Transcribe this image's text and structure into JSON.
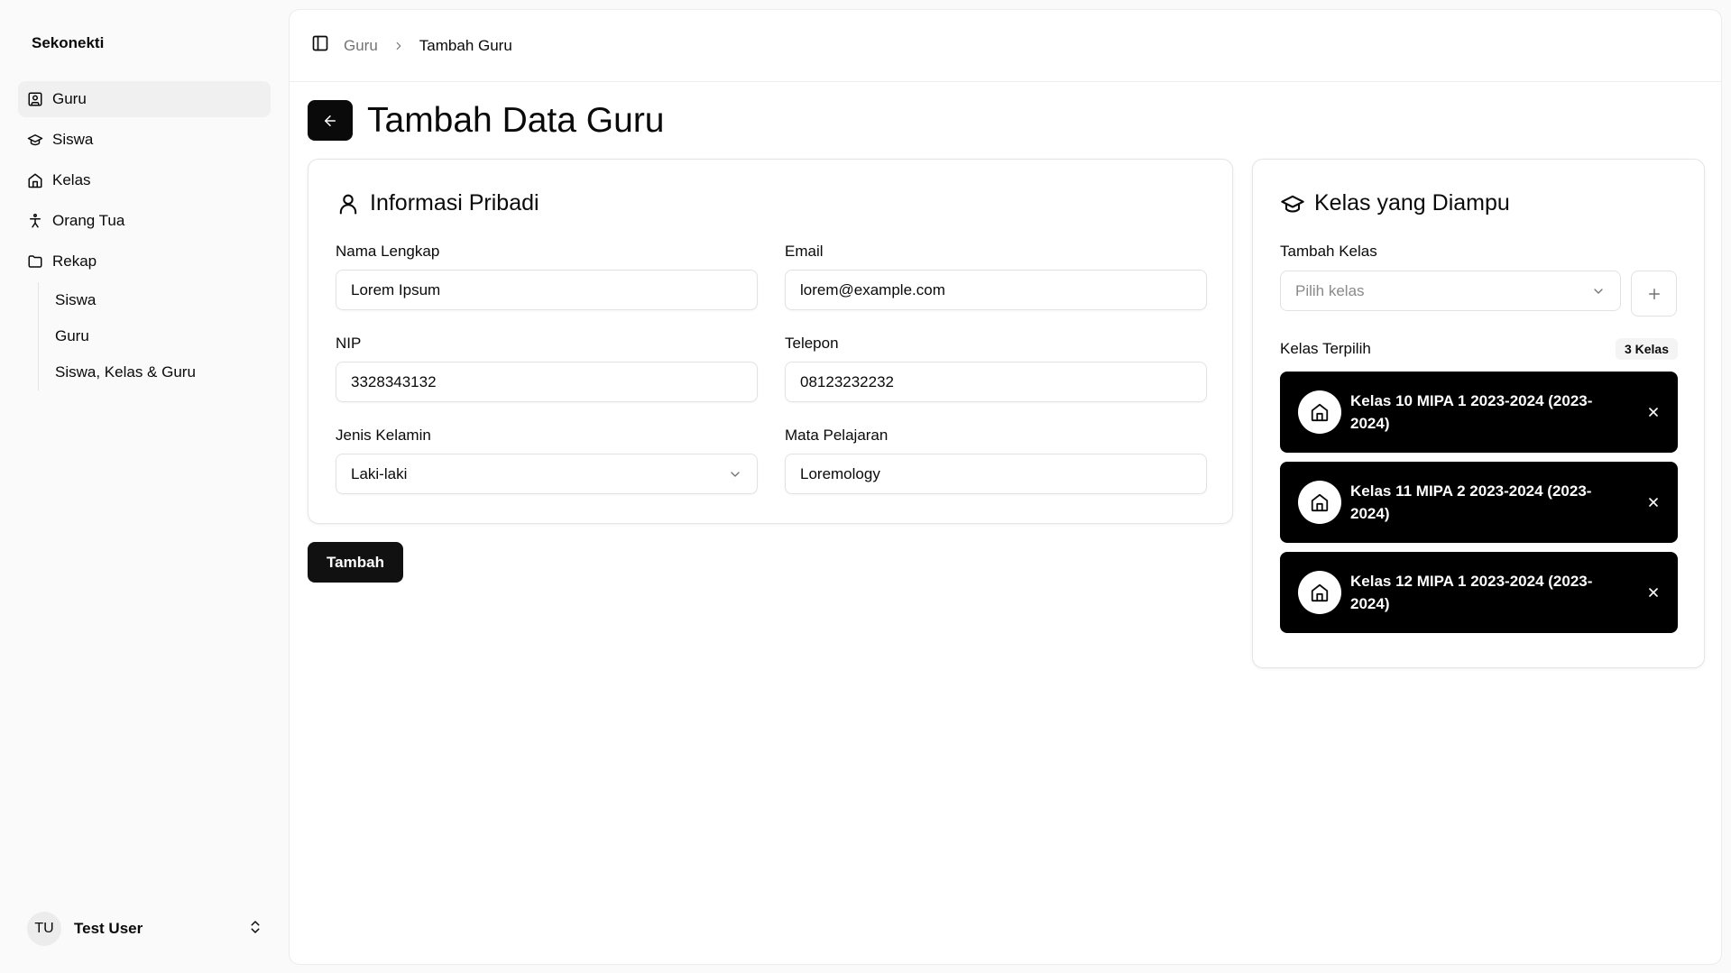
{
  "sidebar": {
    "brand": "Sekonekti",
    "items": [
      {
        "label": "Guru",
        "icon": "user-square-icon",
        "active": true
      },
      {
        "label": "Siswa",
        "icon": "graduation-cap-icon"
      },
      {
        "label": "Kelas",
        "icon": "home-icon"
      },
      {
        "label": "Orang Tua",
        "icon": "person-icon"
      },
      {
        "label": "Rekap",
        "icon": "folder-icon"
      }
    ],
    "rekap_sub": [
      "Siswa",
      "Guru",
      "Siswa, Kelas & Guru"
    ],
    "user": {
      "initials": "TU",
      "name": "Test User"
    }
  },
  "breadcrumb": {
    "parent": "Guru",
    "current": "Tambah Guru"
  },
  "page_title": "Tambah Data Guru",
  "personal": {
    "title": "Informasi Pribadi",
    "fields": {
      "nama": {
        "label": "Nama Lengkap",
        "value": "Lorem Ipsum"
      },
      "email": {
        "label": "Email",
        "value": "lorem@example.com"
      },
      "nip": {
        "label": "NIP",
        "value": "3328343132"
      },
      "telepon": {
        "label": "Telepon",
        "value": "08123232232"
      },
      "gender": {
        "label": "Jenis Kelamin",
        "value": "Laki-laki"
      },
      "mapel": {
        "label": "Mata Pelajaran",
        "value": "Loremology"
      }
    }
  },
  "submit_label": "Tambah",
  "classes": {
    "title": "Kelas yang Diampu",
    "add_label": "Tambah Kelas",
    "select_placeholder": "Pilih kelas",
    "selected_label": "Kelas Terpilih",
    "count_badge": "3 Kelas",
    "items": [
      "Kelas 10 MIPA 1 2023-2024 (2023-2024)",
      "Kelas 11 MIPA 2 2023-2024 (2023-2024)",
      "Kelas 12 MIPA 1 2023-2024 (2023-2024)"
    ]
  },
  "colors": {
    "primary": "#0a0a0a",
    "background": "#fafafa",
    "border": "#e5e5e5"
  }
}
